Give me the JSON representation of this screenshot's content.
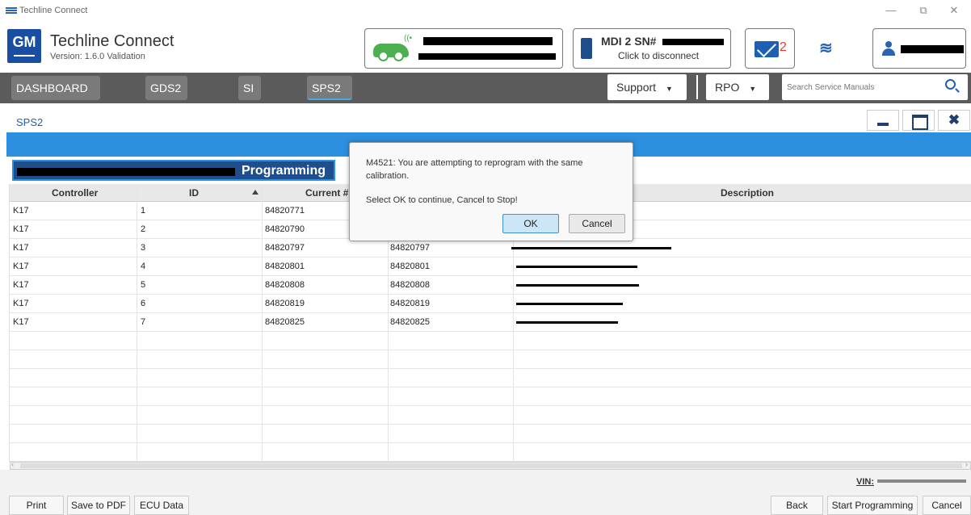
{
  "window": {
    "title": "Techline Connect",
    "min": "—",
    "max": "⧉",
    "close": "✕"
  },
  "header": {
    "brand": "GM",
    "title": "Techline Connect",
    "version": "Version: 1.6.0 Validation",
    "mdi_label": "MDI 2 SN#",
    "mdi_sub": "Click to disconnect",
    "mail_count": "2"
  },
  "nav": {
    "tabs": [
      "DASHBOARD",
      "GDS2",
      "SI",
      "SPS2"
    ],
    "support": "Support",
    "rpo": "RPO",
    "search_placeholder": "Search Service Manuals"
  },
  "page": {
    "section_label": "SPS2",
    "programming_label": "Programming"
  },
  "table": {
    "headers": [
      "Controller",
      "ID",
      "Current #",
      "Description"
    ],
    "rows": [
      [
        "K17",
        "1",
        "84820771",
        ""
      ],
      [
        "K17",
        "2",
        "84820790",
        ""
      ],
      [
        "K17",
        "3",
        "84820797",
        "84820797"
      ],
      [
        "K17",
        "4",
        "84820801",
        "84820801"
      ],
      [
        "K17",
        "5",
        "84820808",
        "84820808"
      ],
      [
        "K17",
        "6",
        "84820819",
        "84820819"
      ],
      [
        "K17",
        "7",
        "84820825",
        "84820825"
      ]
    ]
  },
  "footer": {
    "vin_label": "VIN:",
    "print": "Print",
    "save_pdf": "Save to PDF",
    "ecu_data": "ECU Data",
    "back": "Back",
    "start": "Start Programming",
    "cancel": "Cancel"
  },
  "dialog": {
    "message": "M4521: You are attempting to reprogram with the same calibration.",
    "question": "Select OK to continue, Cancel to Stop!",
    "ok": "OK",
    "cancel": "Cancel"
  },
  "colors": {
    "accent": "#2d8fe0",
    "brand": "#1a4ea3",
    "nav": "#5b5b5b",
    "alert": "#e53935",
    "status_ok": "#4caf50"
  }
}
